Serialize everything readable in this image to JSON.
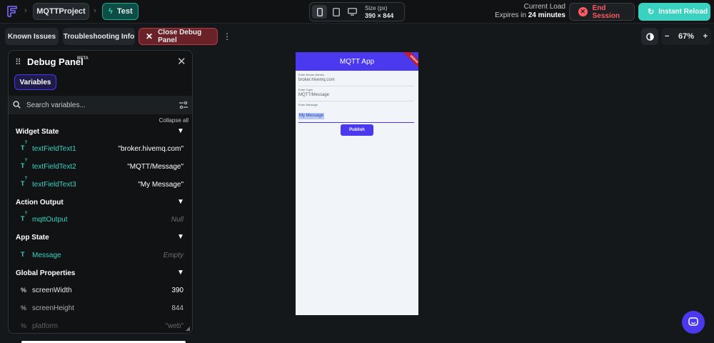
{
  "topbar": {
    "project": "MQTTProject",
    "mode": "Test",
    "device": {
      "size_label": "Size (px)",
      "size_value": "390 × 844",
      "active": "phone"
    },
    "current_load_label": "Current Load",
    "expires_prefix": "Expires in",
    "expires_value": "24 minutes",
    "end_session": "End Session",
    "instant_reload": "Instant Reload"
  },
  "toolbar": {
    "known_issues": "Known Issues",
    "troubleshooting": "Troubleshooting Info",
    "close_debug": "Close Debug Panel",
    "zoom_minus": "−",
    "zoom_value": "67%",
    "zoom_plus": "+"
  },
  "debug_panel": {
    "title": "Debug Panel",
    "badge": "BETA",
    "tab": "Variables",
    "search_placeholder": "Search variables...",
    "collapse_all": "Collapse all",
    "sections": {
      "widget_state": {
        "title": "Widget State",
        "items": [
          {
            "name": "textFieldText1",
            "value": "\"broker.hivemq.com\""
          },
          {
            "name": "textFieldText2",
            "value": "\"MQTT/Message\""
          },
          {
            "name": "textFieldText3",
            "value": "\"My Message\""
          }
        ]
      },
      "action_output": {
        "title": "Action Output",
        "items": [
          {
            "name": "mqttOutput",
            "value": "Null"
          }
        ]
      },
      "app_state": {
        "title": "App State",
        "items": [
          {
            "name": "Message",
            "value": "Empty"
          }
        ]
      },
      "global_properties": {
        "title": "Global Properties",
        "items": [
          {
            "name": "screenWidth",
            "value": "390"
          },
          {
            "name": "screenHeight",
            "value": "844"
          },
          {
            "name": "platform",
            "value": "\"web\""
          }
        ]
      }
    }
  },
  "phone": {
    "app_title": "MQTT App",
    "ribbon": "DEBUG",
    "fields": [
      {
        "label": "Enter Broker Adress",
        "value": "broker.hivemq.com"
      },
      {
        "label": "Enter Topic",
        "value": "MQTT/Message"
      },
      {
        "label": "Enter Message",
        "value": "My Message"
      }
    ],
    "publish": "Publish"
  },
  "colors": {
    "accent": "#4b39ef",
    "teal": "#39d2c0",
    "danger": "#ff5963",
    "background": "#14181b"
  }
}
